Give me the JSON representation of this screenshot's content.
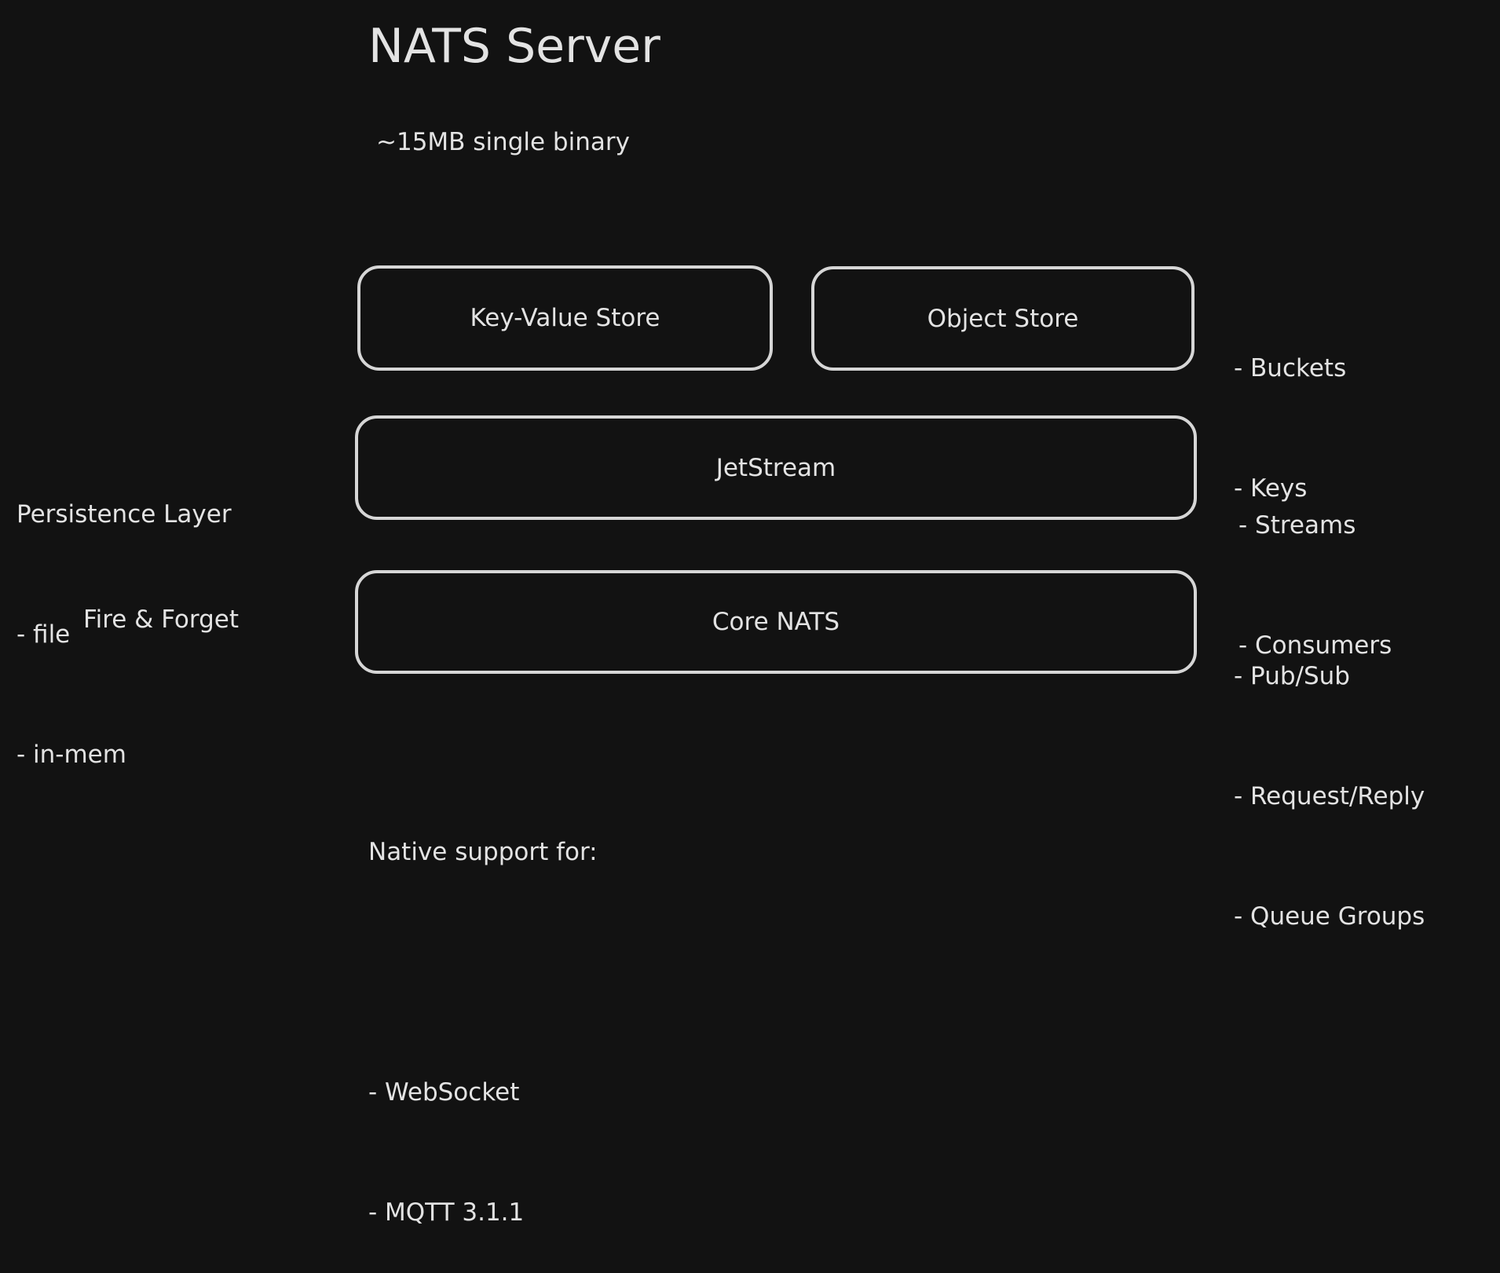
{
  "title": "NATS Server",
  "subtitle": "~15MB single binary",
  "boxes": {
    "kv": "Key-Value Store",
    "object": "Object Store",
    "jetstream": "JetStream",
    "core": "Core NATS"
  },
  "store_notes": [
    "- Buckets",
    "- Keys"
  ],
  "jetstream_notes": [
    "- Streams",
    "- Consumers"
  ],
  "core_notes": [
    "- Pub/Sub",
    "- Request/Reply",
    "- Queue Groups"
  ],
  "persistence": {
    "heading": "Persistence Layer",
    "items": [
      "- file",
      "- in-mem"
    ]
  },
  "core_left": "Fire & Forget",
  "native": {
    "heading": "Native support for:",
    "items": [
      "- WebSocket",
      "- MQTT 3.1.1"
    ]
  }
}
